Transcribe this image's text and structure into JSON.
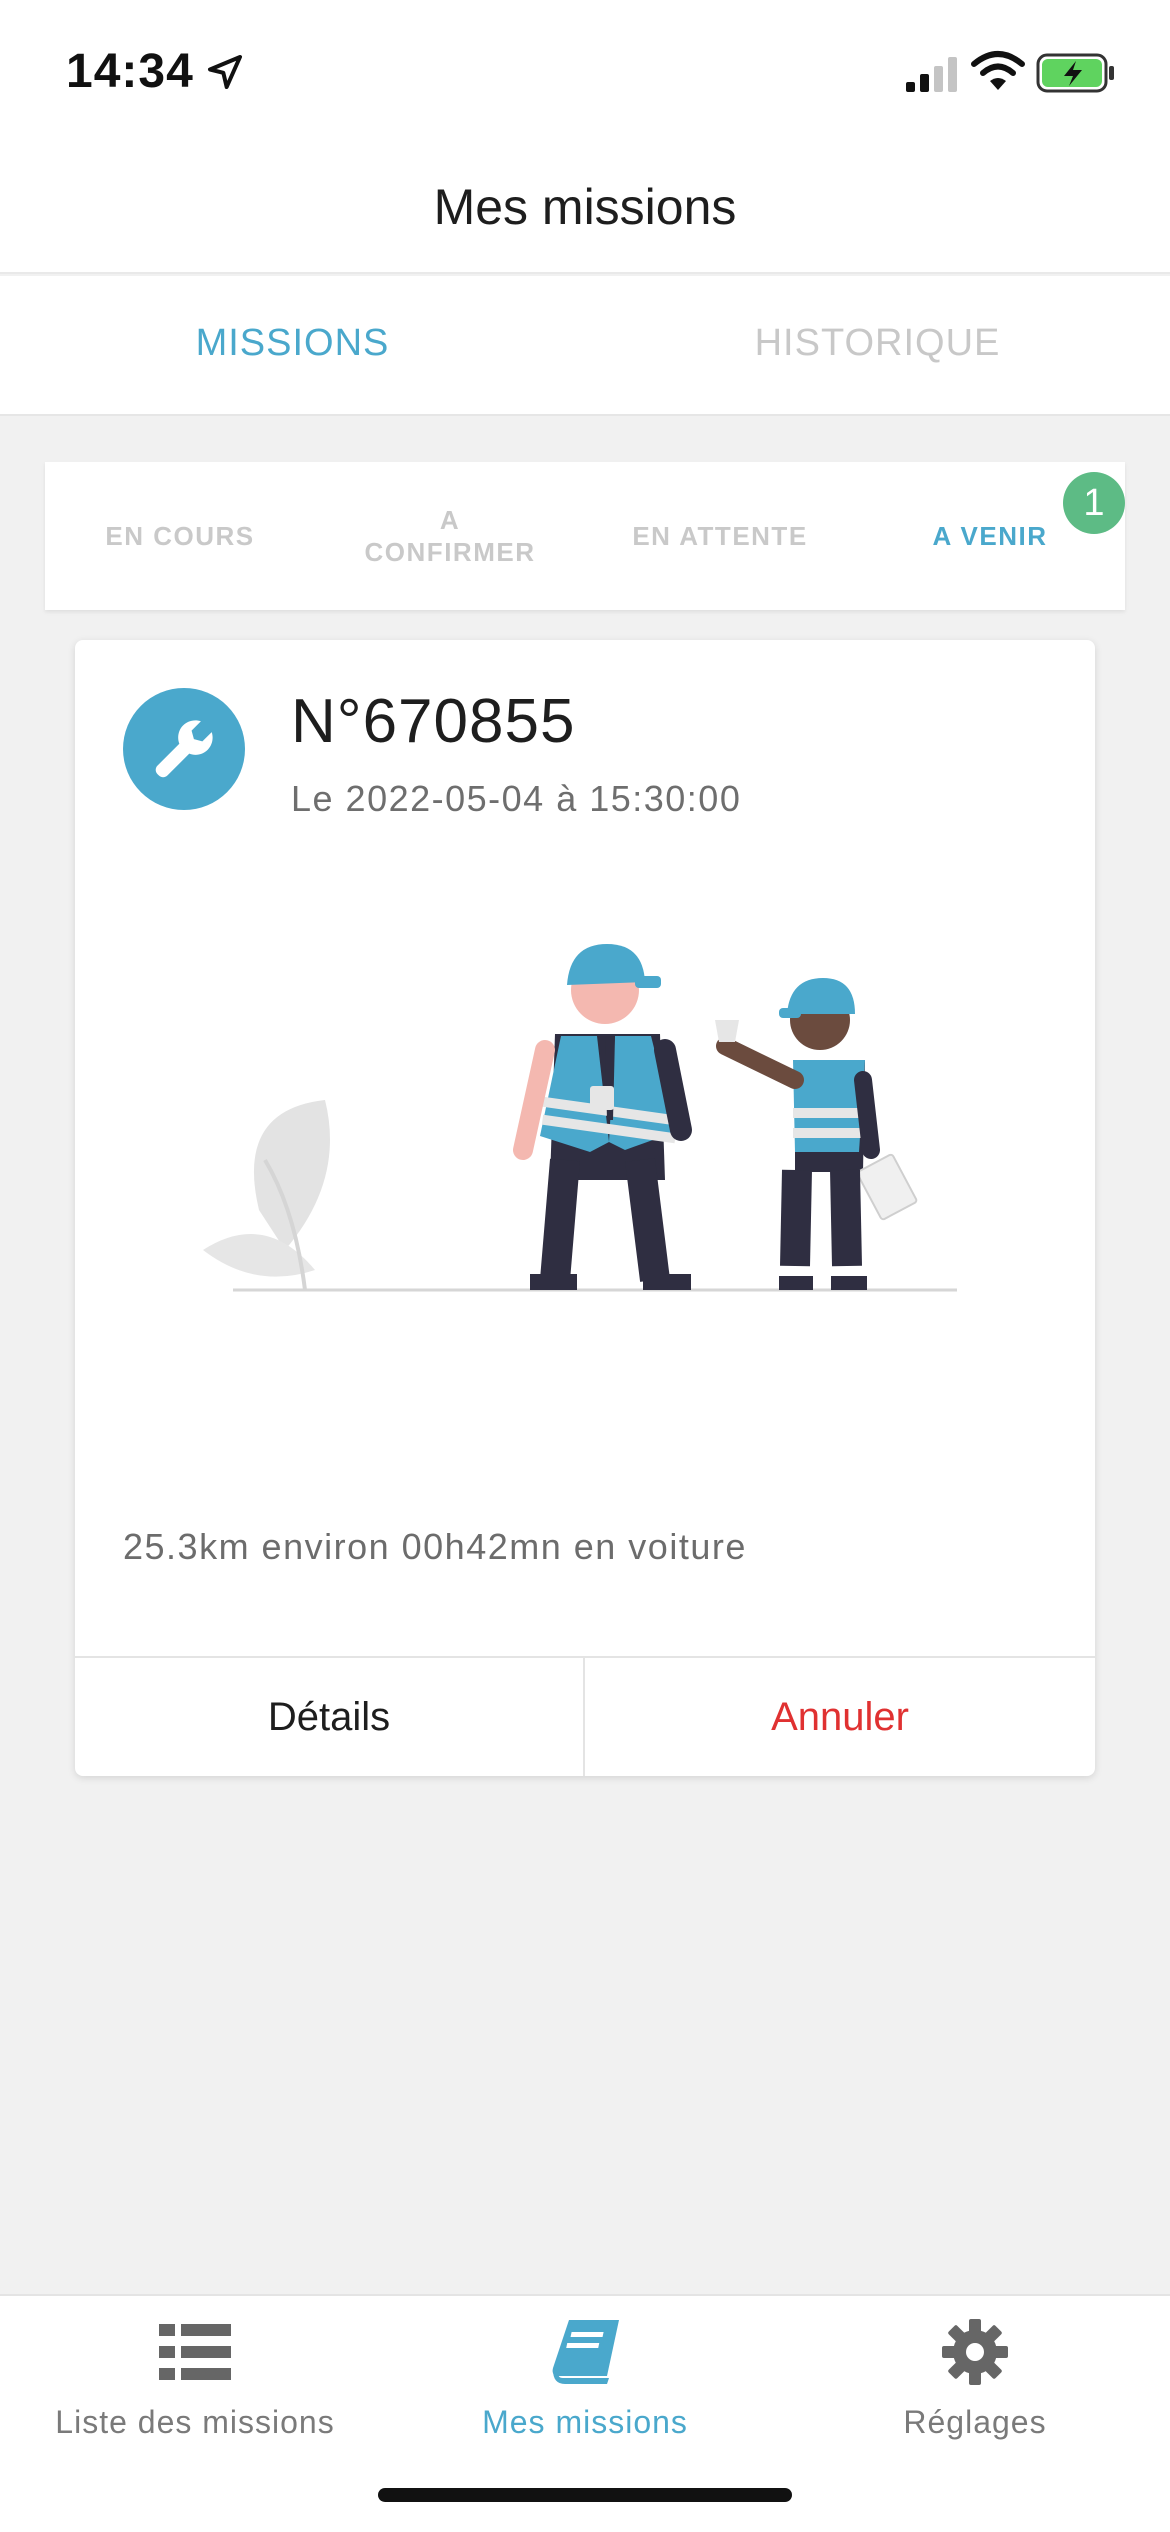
{
  "status_bar": {
    "time": "14:34",
    "icons": [
      "location-arrow-icon",
      "cellular-signal-icon",
      "wifi-icon",
      "battery-charging-icon"
    ]
  },
  "header": {
    "title": "Mes missions"
  },
  "top_tabs": [
    {
      "label": "MISSIONS",
      "active": true
    },
    {
      "label": "HISTORIQUE",
      "active": false
    }
  ],
  "sub_tabs": [
    {
      "label": "EN COURS",
      "active": false
    },
    {
      "label": "A\nCONFIRMER",
      "active": false
    },
    {
      "label": "EN ATTENTE",
      "active": false
    },
    {
      "label": "A VENIR",
      "active": true
    }
  ],
  "sub_tab_badge": "1",
  "mission": {
    "icon": "wrench-icon",
    "number": "N°670855",
    "date": "Le 2022-05-04 à 15:30:00",
    "distance": "25.3km environ 00h42mn en voiture",
    "details_label": "Détails",
    "cancel_label": "Annuler"
  },
  "bottom_nav": [
    {
      "label": "Liste des missions",
      "icon": "list-icon",
      "active": false
    },
    {
      "label": "Mes missions",
      "icon": "book-icon",
      "active": true
    },
    {
      "label": "Réglages",
      "icon": "gear-icon",
      "active": false
    }
  ],
  "colors": {
    "accent": "#4aa8cc",
    "badge": "#5dbb85",
    "cancel": "#e03131",
    "inactive": "#c8c8c8"
  }
}
